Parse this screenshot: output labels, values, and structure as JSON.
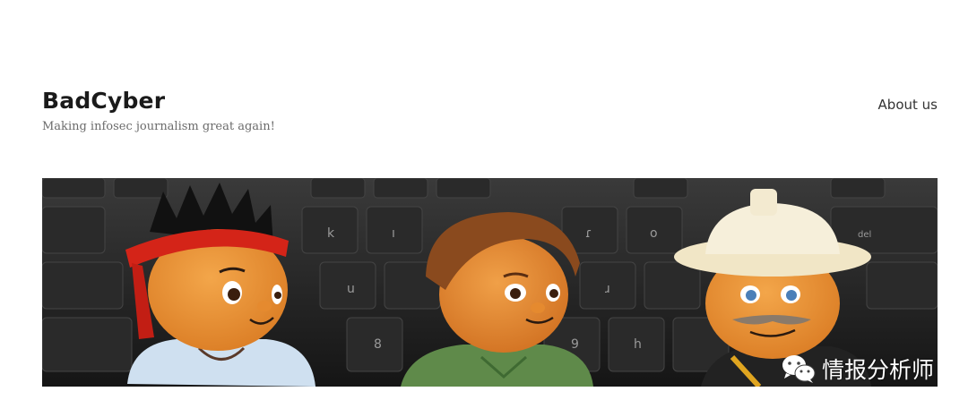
{
  "site": {
    "title": "BadCyber",
    "tagline": "Making infosec journalism great again!"
  },
  "nav": {
    "items": [
      {
        "label": "About us"
      }
    ]
  },
  "banner": {
    "watermark_text": "情报分析师",
    "watermark_icon": "wechat-logo-icon"
  },
  "colors": {
    "title": "#1a1a1a",
    "tagline": "#6b6b6b",
    "nav": "#333333",
    "banner_bg": "#1c1c1c"
  }
}
